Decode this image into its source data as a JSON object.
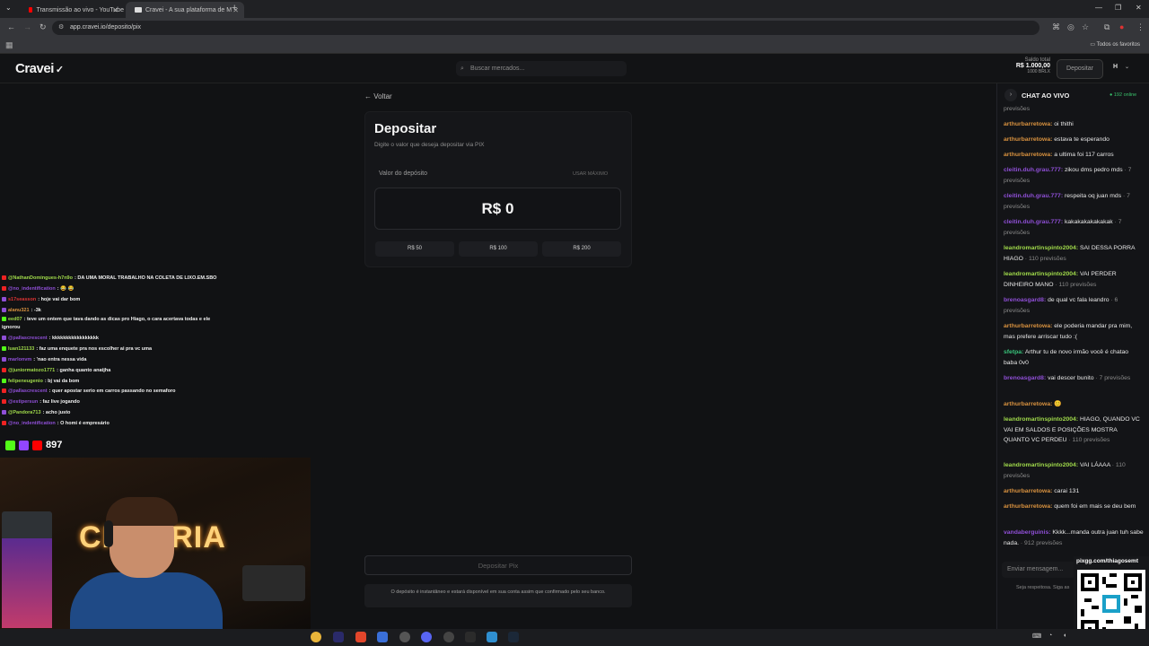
{
  "browser": {
    "tabs": [
      {
        "title": "Transmissão ao vivo - YouTube",
        "active": false
      },
      {
        "title": "Cravei - A sua plataforma de M",
        "active": true
      }
    ],
    "url": "app.cravei.io/deposito/pix",
    "bookmarks_label": "Todos os favoritos"
  },
  "header": {
    "logo": "Cravei",
    "search_placeholder": "Buscar mercados...",
    "balance_label": "Saldo total",
    "balance_value": "R$ 1.000,00",
    "balance_sub": "1000 BRLX",
    "deposit_button": "Depositar",
    "avatar_initial": "H"
  },
  "deposit": {
    "back": "Voltar",
    "title": "Depositar",
    "subtitle": "Digite o valor que deseja depositar via PIX",
    "amount_label": "Valor do depósito",
    "max_button": "USAR MÁXIMO",
    "amount_value": "R$ 0",
    "quick_amounts": [
      "R$ 50",
      "R$ 100",
      "R$ 200"
    ],
    "submit": "Depositar Pix",
    "notice": "O depósito é instantâneo e estará disponível em sua conta assim que confirmado pelo seu banco."
  },
  "live_chat": {
    "title": "CHAT AO VIVO",
    "online": "192 online",
    "input_placeholder": "Enviar mensagem...",
    "rules": "Seja respeitosa. Siga as",
    "messages": [
      {
        "user": "",
        "text": "",
        "meta": "previsões"
      },
      {
        "user": "arthurbarretowa:",
        "text": "oi thithi",
        "meta": ""
      },
      {
        "user": "arthurbarretowa:",
        "text": "estava te esperando",
        "meta": ""
      },
      {
        "user": "arthurbarretowa:",
        "text": "a ultima foi 117 carros",
        "meta": ""
      },
      {
        "user": "cleitin.duh.grau.777:",
        "text": "zikou dms pedro mds",
        "meta": "· 7 previsões"
      },
      {
        "user": "cleitin.duh.grau.777:",
        "text": "respeita oq juan mds",
        "meta": "· 7 previsões"
      },
      {
        "user": "cleitin.duh.grau.777:",
        "text": "kakakakakakakak",
        "meta": "· 7 previsões"
      },
      {
        "user": "leandromartinspinto2004:",
        "text": "SAI DESSA PORRA HIAGO",
        "meta": "· 110 previsões"
      },
      {
        "user": "leandromartinspinto2004:",
        "text": "VAI PERDER DINHEIRO MANO",
        "meta": "· 110 previsões"
      },
      {
        "user": "brenoasgard8:",
        "text": "de qual vc fala leandro",
        "meta": "· 6 previsões"
      },
      {
        "user": "arthurbarretowa:",
        "text": "ele poderia mandar pra mim, mas prefere arriscar tudo :(",
        "meta": ""
      },
      {
        "user": "sfetpa:",
        "text": "Arthur tu de novo irmão você é chatao baba 0v0",
        "meta": ""
      },
      {
        "user": "brenoasgard8:",
        "text": "vai descer bunito",
        "meta": "· 7 previsões"
      },
      {
        "user": "arthurbarretowa:",
        "text": "😊",
        "meta": ""
      },
      {
        "user": "leandromartinspinto2004:",
        "text": "HIAGO, QUANDO VC VAI EM SALDOS E POSIÇÕES MOSTRA QUANTO VC PERDEU",
        "meta": "· 110 previsões"
      },
      {
        "user": "leandromartinspinto2004:",
        "text": "VAI LÁAAA",
        "meta": "· 110 previsões"
      },
      {
        "user": "arthurbarretowa:",
        "text": "carai 131",
        "meta": ""
      },
      {
        "user": "arthurbarretowa:",
        "text": "quem foi em mais se deu bem",
        "meta": ""
      },
      {
        "user": "vandaberguinis:",
        "text": "Kkkk...manda outra juan tuh sabe nada.",
        "meta": "· 912 previsões"
      }
    ]
  },
  "overlay": {
    "chat": [
      {
        "user": "@NathanDomingues-h7n9o",
        "text": ": DA UMA MORAL TRABALHO NA COLETA DE LIXO.EM.SBO"
      },
      {
        "user": "@no_indentification",
        "text": ": 😂 😂"
      },
      {
        "user": "s17seasson",
        "text": ": hoje vai dar bom"
      },
      {
        "user": "alanu321",
        "text": ": -3k"
      },
      {
        "user": "eed07",
        "text": ": teve um ontem que tava dando as dicas pro Hiago, o cara acertava todas e ele ignorou"
      },
      {
        "user": "@pallascrescent",
        "text": ": kkkkkkkkkkkkkkkkk"
      },
      {
        "user": "luan121133",
        "text": ": faz uma enquete pra nos escolher ai pra vc uma"
      },
      {
        "user": "marlonvm",
        "text": ": 'nao entra nessa vida"
      },
      {
        "user": "@juniormatozo1771",
        "text": ": ganha quanto anatjha"
      },
      {
        "user": "felipeneugenio",
        "text": ": bj vai da bom"
      },
      {
        "user": "@pallascrescent",
        "text": ": quer apostar serio em carros passando no semaforo"
      },
      {
        "user": "@estipersun",
        "text": ": faz live jogando"
      },
      {
        "user": "@Pandora713",
        "text": ": acho justo"
      },
      {
        "user": "@no_indentification",
        "text": ": O homi é empresário"
      }
    ],
    "viewers": "897",
    "neon_text": "CHURRIA",
    "pix_label": "pixgg.com/thiagosemt"
  },
  "colors": {
    "username_orange": "#d9923f",
    "username_purple": "#8f4fd6",
    "username_green": "#9fd94a",
    "online_green": "#39c26b",
    "background": "#111214"
  }
}
